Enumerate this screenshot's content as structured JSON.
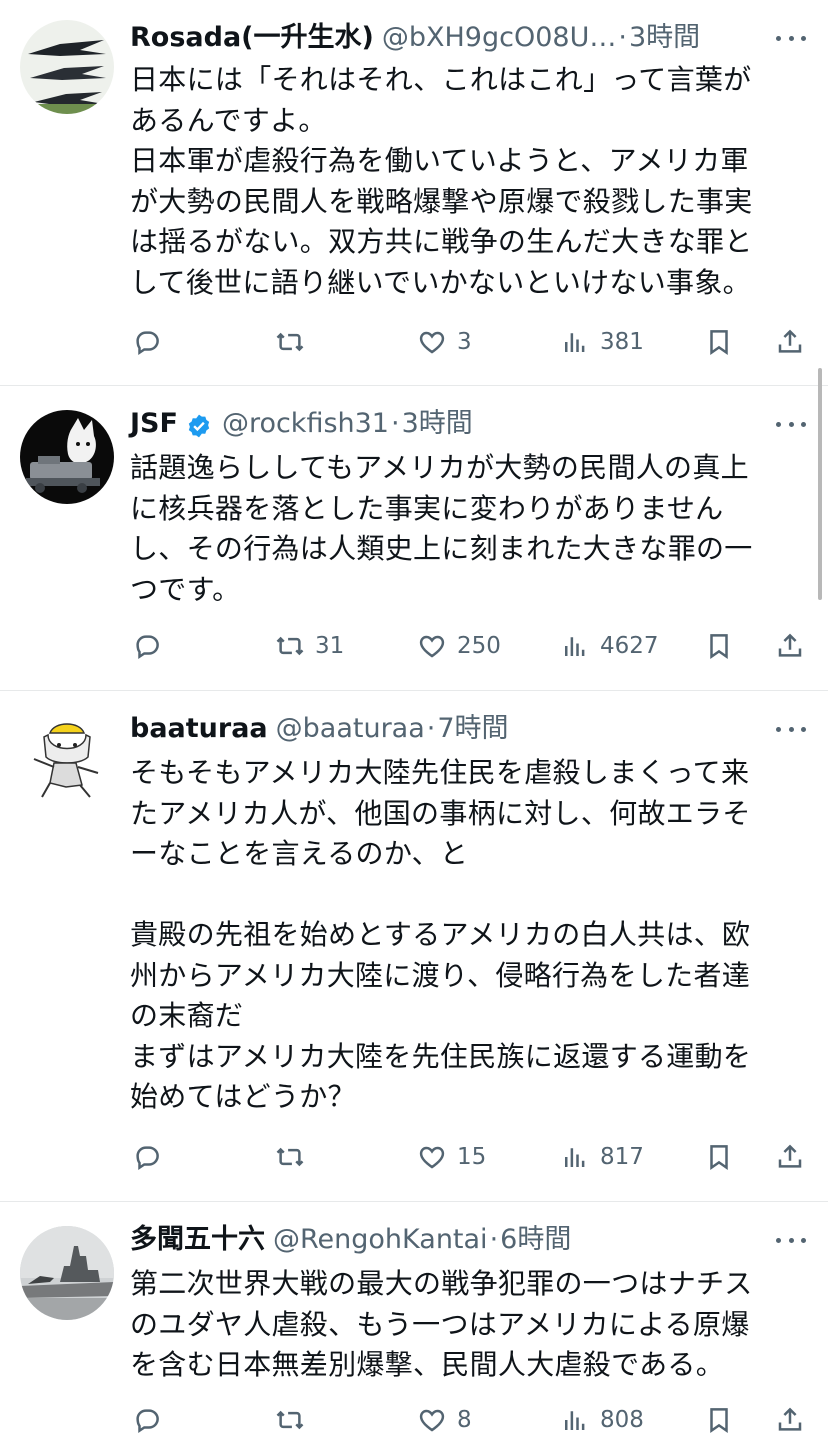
{
  "tweets": [
    {
      "name": "Rosada(一升生水)",
      "handle": "@bXH9gcO08U…",
      "time": "3時間",
      "verified": false,
      "text": "日本には「それはそれ、これはこれ」って言葉が\nあるんですよ。\n日本軍が虐殺行為を働いていようと、アメリカ軍\nが大勢の民間人を戦略爆撃や原爆で殺戮した事実\nは揺るがない。双方共に戦争の生んだ大きな罪と\nして後世に語り継いでいかないといけない事象。",
      "replies": "",
      "reposts": "",
      "likes": "3",
      "views": "381"
    },
    {
      "name": "JSF",
      "handle": "@rockfish31",
      "time": "3時間",
      "verified": true,
      "text": "話題逸らししてもアメリカが大勢の民間人の真上\nに核兵器を落とした事実に変わりがありません\nし、その行為は人類史上に刻まれた大きな罪の一\nつです。",
      "replies": "",
      "reposts": "31",
      "likes": "250",
      "views": "4627"
    },
    {
      "name": "baaturaa",
      "handle": "@baaturaa",
      "time": "7時間",
      "verified": false,
      "text": "そもそもアメリカ大陸先住民を虐殺しまくって来\nたアメリカ人が、他国の事柄に対し、何故エラそ\nーなことを言えるのか、と\n\n貴殿の先祖を始めとするアメリカの白人共は、欧\n州からアメリカ大陸に渡り、侵略行為をした者達\nの末裔だ\nまずはアメリカ大陸を先住民族に返還する運動を\n始めてはどうか？",
      "replies": "",
      "reposts": "",
      "likes": "15",
      "views": "817"
    },
    {
      "name": "多聞五十六",
      "handle": "@RengohKantai",
      "time": "6時間",
      "verified": false,
      "text": "第二次世界大戦の最大の戦争犯罪の一つはナチス\nのユダヤ人虐殺、もう一つはアメリカによる原爆\nを含む日本無差別爆撃、民間人大虐殺である。",
      "replies": "",
      "reposts": "",
      "likes": "8",
      "views": "808"
    }
  ],
  "icons": {
    "reply": "reply-icon",
    "repost": "repost-icon",
    "like": "heart-icon",
    "views": "views-icon",
    "bookmark": "bookmark-icon",
    "share": "share-icon",
    "more": "more-icon",
    "verified": "verified-badge-icon"
  },
  "colors": {
    "text": "#0f1419",
    "secondary": "#536471",
    "verified": "#1d9bf0",
    "divider": "#e7e9ea"
  }
}
